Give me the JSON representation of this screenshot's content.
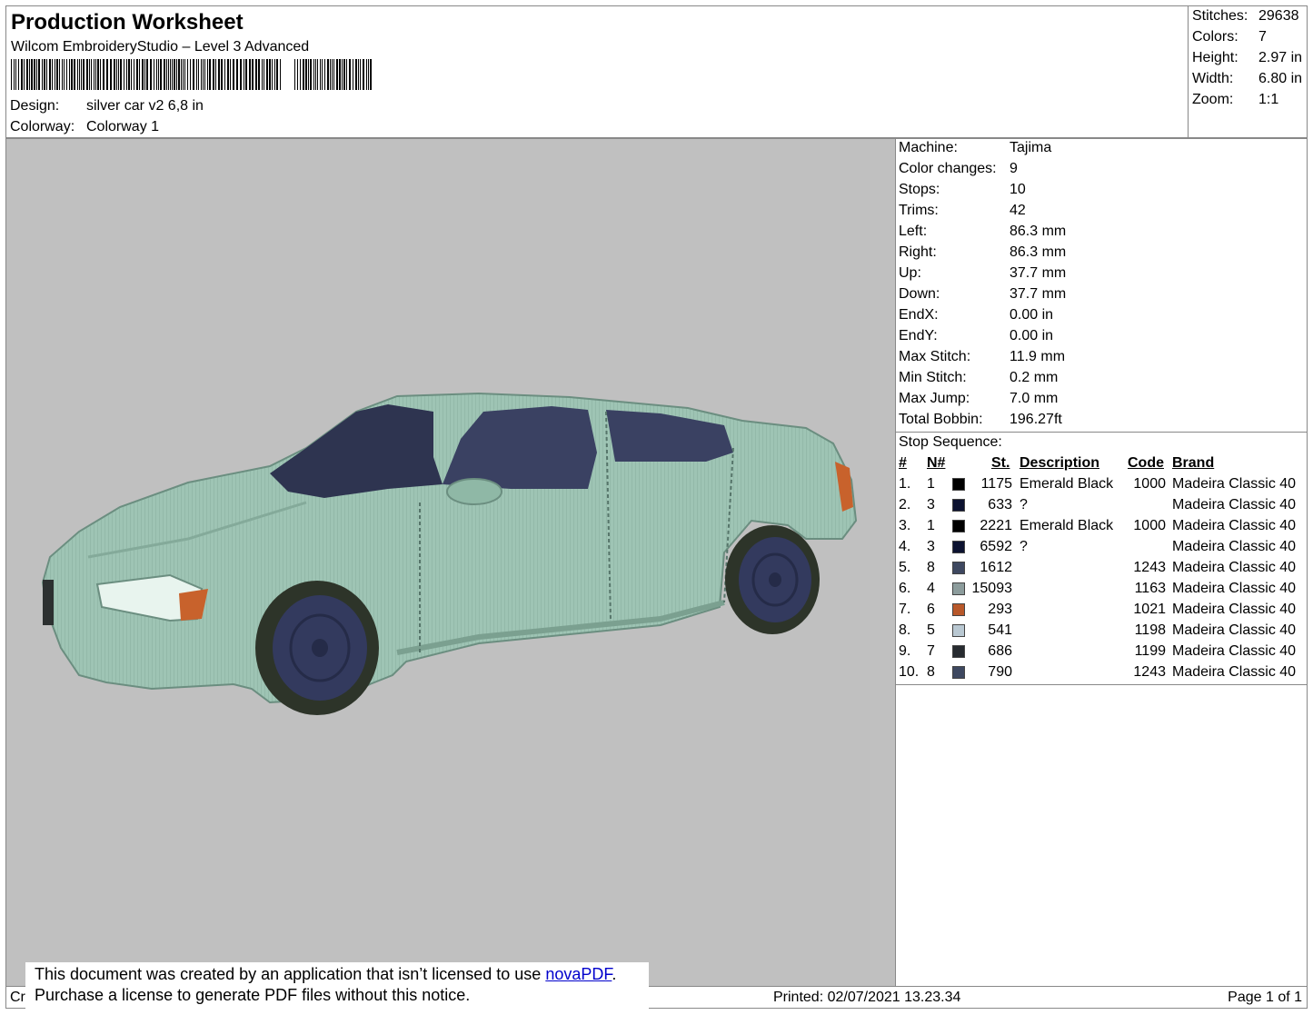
{
  "header": {
    "title": "Production Worksheet",
    "subtitle": "Wilcom EmbroideryStudio – Level 3 Advanced",
    "design_label": "Design:",
    "design_value": "silver car v2 6,8 in",
    "colorway_label": "Colorway:",
    "colorway_value": "Colorway 1"
  },
  "summary": [
    {
      "label": "Stitches:",
      "value": "29638"
    },
    {
      "label": "Colors:",
      "value": "7"
    },
    {
      "label": "Height:",
      "value": "2.97 in"
    },
    {
      "label": "Width:",
      "value": "6.80 in"
    },
    {
      "label": "Zoom:",
      "value": "1:1"
    }
  ],
  "machine_info": [
    {
      "label": "Machine:",
      "value": "Tajima"
    },
    {
      "label": "Color changes:",
      "value": "9"
    },
    {
      "label": "Stops:",
      "value": "10"
    },
    {
      "label": "Trims:",
      "value": "42"
    },
    {
      "label": "Left:",
      "value": "86.3 mm"
    },
    {
      "label": "Right:",
      "value": "86.3 mm"
    },
    {
      "label": "Up:",
      "value": "37.7 mm"
    },
    {
      "label": "Down:",
      "value": "37.7 mm"
    },
    {
      "label": "EndX:",
      "value": "0.00 in"
    },
    {
      "label": "EndY:",
      "value": "0.00 in"
    },
    {
      "label": "Max Stitch:",
      "value": "11.9 mm"
    },
    {
      "label": "Min Stitch:",
      "value": "0.2 mm"
    },
    {
      "label": "Max Jump:",
      "value": "7.0 mm"
    },
    {
      "label": "Total Bobbin:",
      "value": "196.27ft"
    }
  ],
  "stop_sequence": {
    "title": "Stop Sequence:",
    "headers": {
      "num": "#",
      "needle": "N#",
      "stitches": "St.",
      "description": "Description",
      "code": "Code",
      "brand": "Brand"
    },
    "rows": [
      {
        "num": "1.",
        "needle": "1",
        "color": "#000000",
        "stitches": "1175",
        "description": "Emerald Black",
        "code": "1000",
        "brand": "Madeira Classic 40"
      },
      {
        "num": "2.",
        "needle": "3",
        "color": "#0c1230",
        "stitches": "633",
        "description": "?",
        "code": "",
        "brand": "Madeira Classic 40"
      },
      {
        "num": "3.",
        "needle": "1",
        "color": "#000000",
        "stitches": "2221",
        "description": "Emerald Black",
        "code": "1000",
        "brand": "Madeira Classic 40"
      },
      {
        "num": "4.",
        "needle": "3",
        "color": "#0c1230",
        "stitches": "6592",
        "description": "?",
        "code": "",
        "brand": "Madeira Classic 40"
      },
      {
        "num": "5.",
        "needle": "8",
        "color": "#3e4860",
        "stitches": "1612",
        "description": "",
        "code": "1243",
        "brand": "Madeira Classic 40"
      },
      {
        "num": "6.",
        "needle": "4",
        "color": "#8c9c9c",
        "stitches": "15093",
        "description": "",
        "code": "1163",
        "brand": "Madeira Classic 40"
      },
      {
        "num": "7.",
        "needle": "6",
        "color": "#b8582a",
        "stitches": "293",
        "description": "",
        "code": "1021",
        "brand": "Madeira Classic 40"
      },
      {
        "num": "8.",
        "needle": "5",
        "color": "#b9c8d2",
        "stitches": "541",
        "description": "",
        "code": "1198",
        "brand": "Madeira Classic 40"
      },
      {
        "num": "9.",
        "needle": "7",
        "color": "#272b30",
        "stitches": "686",
        "description": "",
        "code": "1199",
        "brand": "Madeira Classic 40"
      },
      {
        "num": "10.",
        "needle": "8",
        "color": "#3e4860",
        "stitches": "790",
        "description": "",
        "code": "1243",
        "brand": "Madeira Classic 40"
      }
    ]
  },
  "footer": {
    "created_fragment": "Cr",
    "printed": "Printed: 02/07/2021 13.23.34",
    "page": "Page 1 of 1"
  },
  "notice": {
    "line1_prefix": "This document was created by an application that isn’t licensed to use ",
    "link_text": "novaPDF",
    "line1_suffix": ".",
    "line2": "Purchase a license to generate PDF files without this notice."
  },
  "colors": {
    "preview_bg": "#c0c0c0",
    "car_body": "#9ec4b4",
    "car_shadow": "#7aa292",
    "glass": "#2e3450",
    "tire": "#2d3429",
    "rim": "#333a5e",
    "indicator": "#c8622c"
  }
}
